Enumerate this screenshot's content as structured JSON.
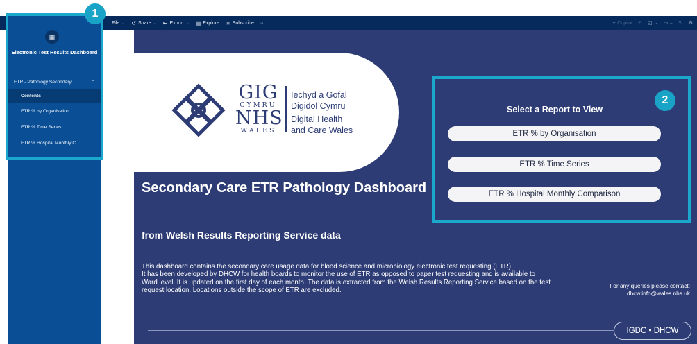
{
  "toolbar": {
    "file_label": "File",
    "share_label": "Share",
    "export_label": "Export",
    "explore_label": "Explore",
    "subscribe_label": "Subscribe",
    "more_label": "···",
    "copilot_label": "Copilot",
    "icons": [
      "file-chevron",
      "share-icon",
      "export-icon",
      "explore-icon",
      "subscribe-icon",
      "undo-icon",
      "bookmark-icon",
      "view-icon",
      "refresh-icon",
      "settings-icon"
    ]
  },
  "sidebar": {
    "app_icon": "report-app-icon",
    "app_title": "Electronic Test Results Dashboard",
    "section_label": "ETR - Pathology Secondary ...",
    "items": [
      {
        "label": "Contents",
        "active": true
      },
      {
        "label": "ETR % by Organisation",
        "active": false
      },
      {
        "label": "ETR % Time Series",
        "active": false
      },
      {
        "label": "ETR % Hospital Monthly C...",
        "active": false
      }
    ]
  },
  "annotations": {
    "badge_1": "1",
    "badge_2": "2",
    "highlight_color": "#1ca8cc"
  },
  "report": {
    "logo": {
      "gig": "GIG",
      "cymru": "CYMRU",
      "nhs": "NHS",
      "wales": "WALES",
      "welsh_line1": "Iechyd a Gofal",
      "welsh_line2": "Digidol Cymru",
      "english_line1": "Digital Health",
      "english_line2": "and Care Wales"
    },
    "title": "Secondary Care ETR Pathology Dashboard",
    "subtitle": "from Welsh Results Reporting Service data",
    "description": "This dashboard contains the secondary care usage data for blood science and microbiology electronic test requesting (ETR).\nIt has been developed by DHCW for health boards to monitor the use of ETR as opposed to paper test requesting and is available to Ward level. It is updated on the first day of each month. The data is extracted from the Welsh Results Reporting Service based on the test request location. Locations outside the scope of ETR are excluded.",
    "select_title": "Select a Report to View",
    "buttons": [
      "ETR % by Organisation",
      "ETR % Time Series",
      "ETR % Hospital Monthly Comparison"
    ],
    "contact_line1": "For any queries please contact:",
    "contact_line2": "dhcw.info@wales.nhs.uk",
    "footer_badge": "IGDC • DHCW",
    "colors": {
      "canvas": "#2d3c75",
      "sidebar": "#0a4f96",
      "toolbar": "#062a5c"
    }
  }
}
